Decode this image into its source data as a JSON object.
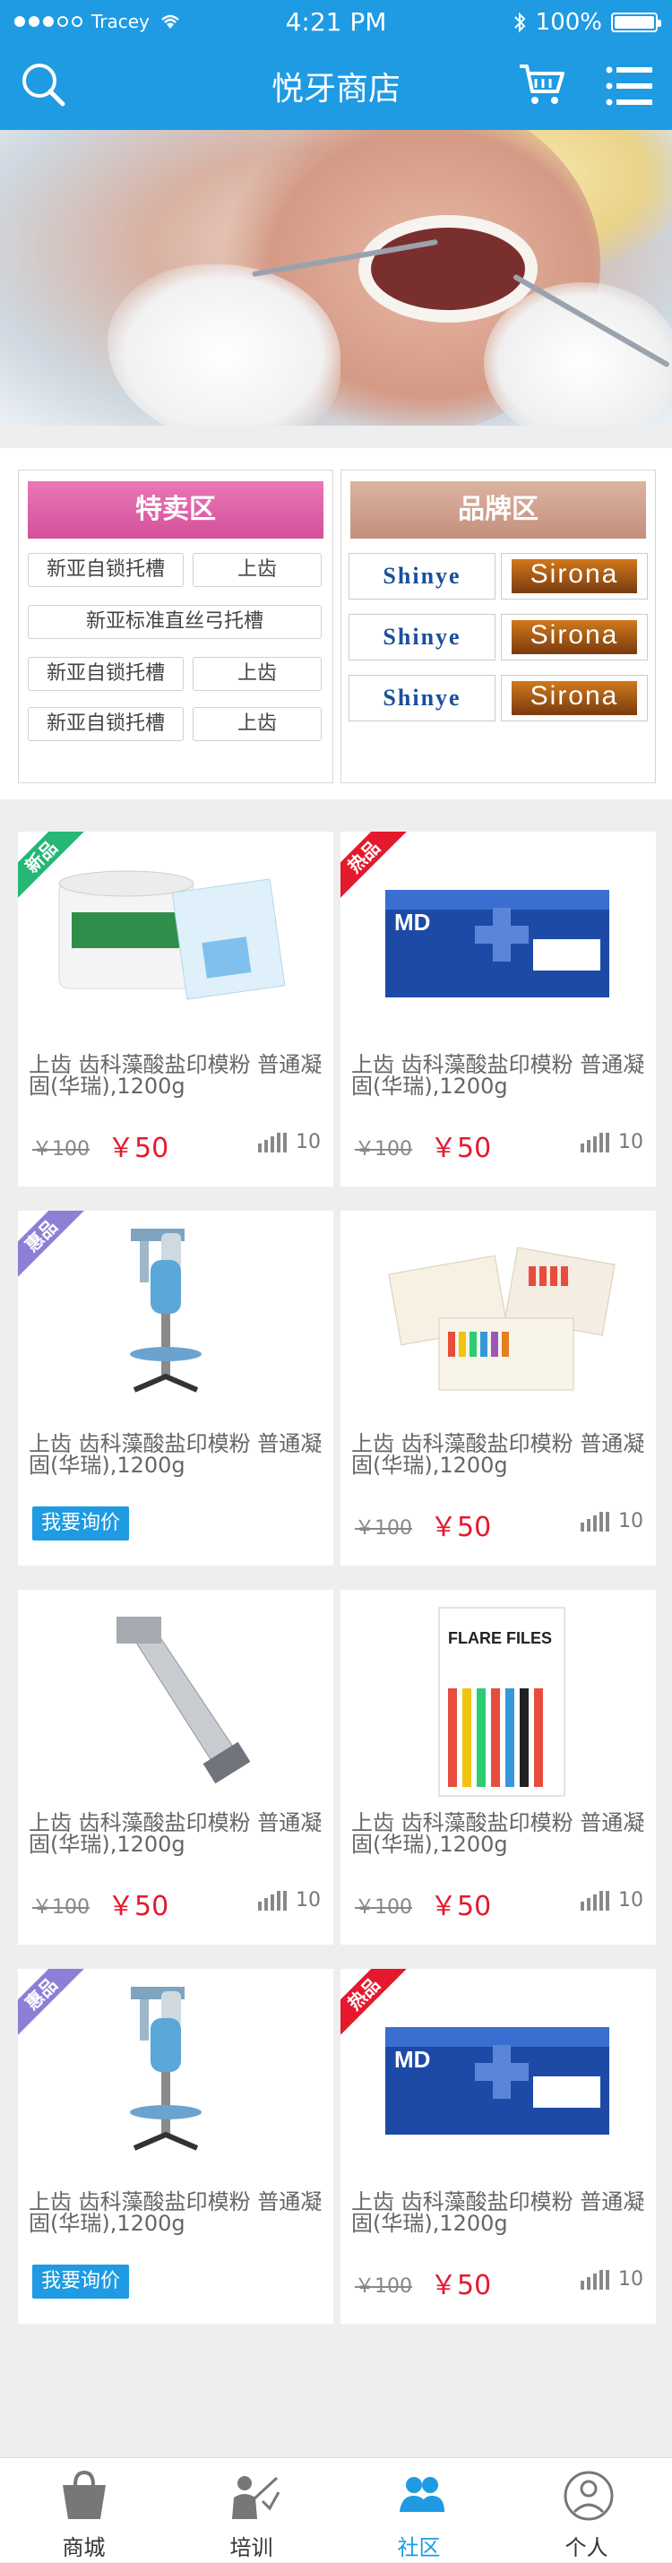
{
  "status_bar": {
    "carrier": "Tracey",
    "time": "4:21 PM",
    "battery": "100%"
  },
  "nav": {
    "title": "悦牙商店"
  },
  "special_zone": {
    "title": "特卖区",
    "tags": [
      "新亚自锁托槽",
      "上齿",
      "新亚标准直丝弓托槽",
      "新亚自锁托槽",
      "上齿",
      "新亚自锁托槽",
      "上齿"
    ]
  },
  "brand_zone": {
    "title": "品牌区",
    "brands": [
      "Shinye",
      "Sirona",
      "Shinye",
      "Sirona",
      "Shinye",
      "Sirona"
    ]
  },
  "products": [
    {
      "badge": "新品",
      "title": "上齿 齿科藻酸盐印模粉 普通凝固(华瑞),1200g",
      "old_price": "￥100",
      "price": "￥50",
      "sales": "10"
    },
    {
      "badge": "热品",
      "title": "上齿 齿科藻酸盐印模粉 普通凝固(华瑞),1200g",
      "old_price": "￥100",
      "price": "￥50",
      "sales": "10"
    },
    {
      "badge": "惠品",
      "title": "上齿 齿科藻酸盐印模粉 普通凝固(华瑞),1200g",
      "inquire": "我要询价"
    },
    {
      "badge": "",
      "title": "上齿 齿科藻酸盐印模粉 普通凝固(华瑞),1200g",
      "old_price": "￥100",
      "price": "￥50",
      "sales": "10"
    },
    {
      "badge": "",
      "title": "上齿 齿科藻酸盐印模粉 普通凝固(华瑞),1200g",
      "old_price": "￥100",
      "price": "￥50",
      "sales": "10"
    },
    {
      "badge": "",
      "title": "上齿 齿科藻酸盐印模粉 普通凝固(华瑞),1200g",
      "old_price": "￥100",
      "price": "￥50",
      "sales": "10"
    },
    {
      "badge": "惠品",
      "title": "上齿 齿科藻酸盐印模粉 普通凝固(华瑞),1200g",
      "inquire": "我要询价"
    },
    {
      "badge": "热品",
      "title": "上齿 齿科藻酸盐印模粉 普通凝固(华瑞),1200g",
      "old_price": "￥100",
      "price": "￥50",
      "sales": "10"
    }
  ],
  "tabbar": {
    "items": [
      {
        "label": "商城",
        "icon": "shopping-bag-icon"
      },
      {
        "label": "培训",
        "icon": "teacher-icon"
      },
      {
        "label": "社区",
        "icon": "community-icon",
        "active": true
      },
      {
        "label": "个人",
        "icon": "person-icon"
      }
    ]
  },
  "colors": {
    "primary": "#1e9be3",
    "price_red": "#e5192e",
    "badge_new": "#25b774",
    "badge_hot": "#e5192e",
    "badge_hui": "#8e7ed6"
  }
}
